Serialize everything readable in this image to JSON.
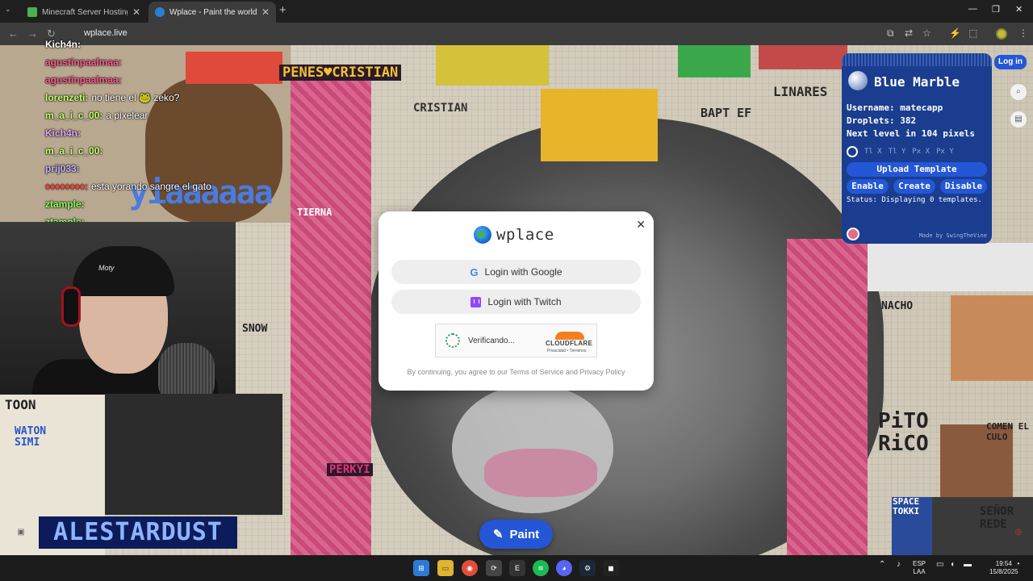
{
  "browser": {
    "tabs": [
      {
        "title": "Minecraft Server Hosting - Spa",
        "active": false
      },
      {
        "title": "Wplace - Paint the world",
        "active": true
      }
    ],
    "url": "wplace.live"
  },
  "canvas_text": {
    "banner": "PENES♥CRISTIAN",
    "cristian": "CRISTIAN",
    "linares": "LINARES",
    "yiaaaa": "yiaaaaaa",
    "bart": "BAPT EF",
    "snow": "SNOW",
    "toon": "TOON",
    "watson": "WATON SIMI",
    "pito": "PiTO RiCO",
    "comen": "COMEN EL CULO",
    "senor": "SEÑOR REDE",
    "space": "SPACE TOKKI",
    "nacho": "NACHO",
    "alestardust": "ALESTARDUST",
    "tierna": "TIERNA",
    "peakyi": "PERKYI"
  },
  "chat": [
    {
      "user": "Kich4n:",
      "msg": "",
      "color": "#ffffff"
    },
    {
      "user": "agustinpaalmaa:",
      "msg": "",
      "color": "#ff5b8c"
    },
    {
      "user": "agustinpaalmaa:",
      "msg": "",
      "color": "#ff5b8c"
    },
    {
      "user": "lorenzeti:",
      "msg": "no tiene el 🐸 zeko?",
      "color": "#c8ff6a"
    },
    {
      "user": "m_a_i_c_00:",
      "msg": "a pixelear",
      "color": "#c8ff6a"
    },
    {
      "user": "Kich4n:",
      "msg": "",
      "color": "#e9a6ff"
    },
    {
      "user": "m_a_i_c_00:",
      "msg": "",
      "color": "#c8ff6a"
    },
    {
      "user": "prij033:",
      "msg": "",
      "color": "#c7b4ff"
    },
    {
      "user": "♦♦♦♦♦♦♦♦:",
      "msg": "esta yorando sangre el gato",
      "color": "#ff4040"
    },
    {
      "user": "ztample:",
      "msg": "",
      "color": "#8cff5a"
    },
    {
      "user": "ztample:",
      "msg": "",
      "color": "#8cff5a"
    }
  ],
  "webcam": {
    "beanie_logo": "Moty"
  },
  "blue_marble": {
    "title": "Blue Marble",
    "username_label": "Username:",
    "username": "matecapp",
    "droplets_label": "Droplets:",
    "droplets": "382",
    "next_level_pre": "Next level in",
    "next_level_value": "104",
    "next_level_post": "pixels",
    "coords": [
      "Tl X",
      "Tl Y",
      "Px X",
      "Px Y"
    ],
    "upload": "Upload Template",
    "enable": "Enable",
    "create": "Create",
    "disable": "Disable",
    "status": "Status: Displaying 0 templates.",
    "made_by": "Made by SwingTheVine"
  },
  "login_button": "Log in",
  "modal": {
    "logo": "wplace",
    "google": "Login with Google",
    "twitch": "Login with Twitch",
    "verifying": "Verificando...",
    "cloudflare": "CLOUDFLARE",
    "cf_links": "Privacidad • Términos",
    "terms": "By continuing, you agree to our Terms of Service and Privacy Policy"
  },
  "paint_button": "Paint",
  "taskbar": {
    "lang_line1": "ESP",
    "lang_line2": "LAA",
    "time": "19:54",
    "date": "15/8/2025"
  },
  "colors": {
    "accent": "#2457d6",
    "panel": "#1a3d8f",
    "twitch": "#9146ff"
  }
}
